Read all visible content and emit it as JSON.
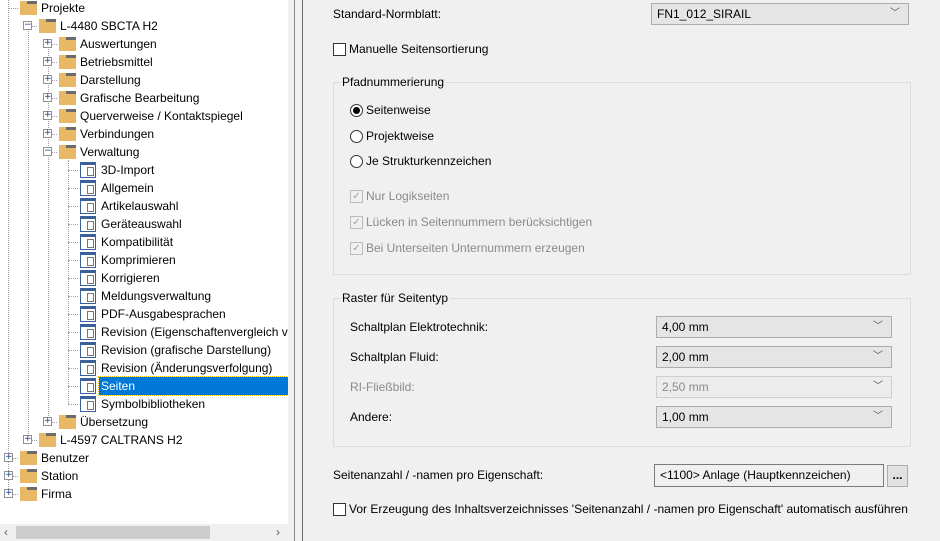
{
  "tree": {
    "root": "Projekte",
    "project1": "L-4480 SBCTA H2",
    "folders": [
      "Auswertungen",
      "Betriebsmittel",
      "Darstellung",
      "Grafische Bearbeitung",
      "Querverweise / Kontaktspiegel",
      "Verbindungen",
      "Verwaltung"
    ],
    "pages": [
      "3D-Import",
      "Allgemein",
      "Artikelauswahl",
      "Geräteauswahl",
      "Kompatibilität",
      "Komprimieren",
      "Korrigieren",
      "Meldungsverwaltung",
      "PDF-Ausgabesprachen",
      "Revision (Eigenschaftenvergleich vo",
      "Revision (grafische Darstellung)",
      "Revision (Änderungsverfolgung)",
      "Seiten",
      "Symbolbibliotheken"
    ],
    "selected": "Seiten",
    "after": "Übersetzung",
    "project2": "L-4597 CALTRANS H2",
    "top": [
      "Benutzer",
      "Station",
      "Firma"
    ]
  },
  "settings": {
    "normblatt_label": "Standard-Normblatt:",
    "normblatt_value": "FN1_012_SIRAIL",
    "manual_sort": "Manuelle Seitensortierung",
    "path_group": "Pfadnummerierung",
    "radios": [
      "Seitenweise",
      "Projektweise",
      "Je Strukturkennzeichen"
    ],
    "radio_selected": "Seitenweise",
    "checks": [
      "Nur Logikseiten",
      "Lücken in Seitennummern berücksichtigen",
      "Bei Unterseiten Unternummern erzeugen"
    ],
    "raster_group": "Raster für Seitentyp",
    "raster": [
      {
        "label": "Schaltplan Elektrotechnik:",
        "value": "4,00 mm",
        "disabled": false
      },
      {
        "label": "Schaltplan Fluid:",
        "value": "2,00 mm",
        "disabled": false
      },
      {
        "label": "RI-Fließbild:",
        "value": "2,50 mm",
        "disabled": true
      },
      {
        "label": "Andere:",
        "value": "1,00 mm",
        "disabled": false
      }
    ],
    "count_label": "Seitenanzahl / -namen pro Eigenschaft:",
    "count_value": "<1100> Anlage (Hauptkennzeichen)",
    "browse_label": "...",
    "auto_run": "Vor Erzeugung des Inhaltsverzeichnisses 'Seitenanzahl / -namen pro Eigenschaft' automatisch ausführen"
  }
}
